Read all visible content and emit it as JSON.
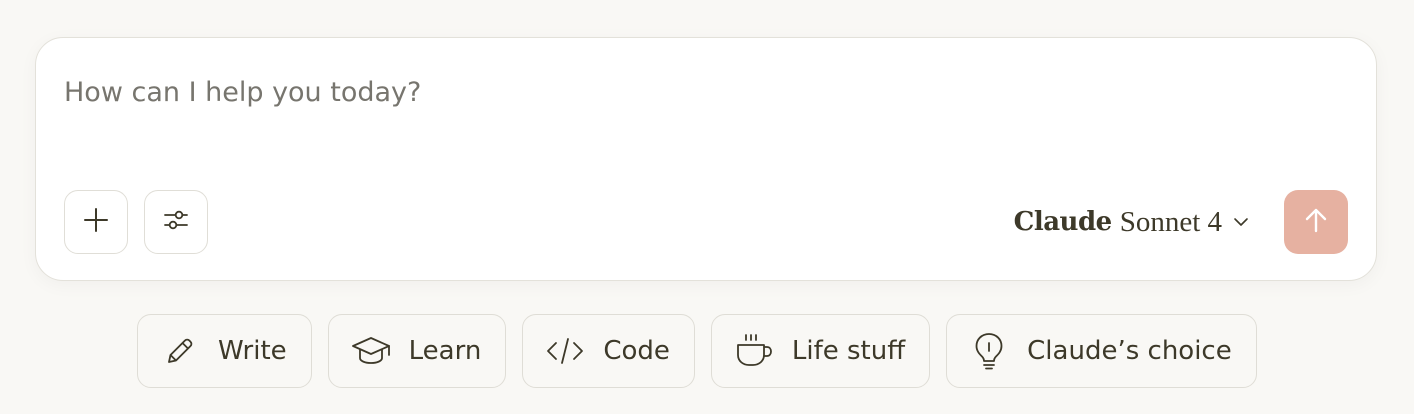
{
  "composer": {
    "placeholder": "How can I help you today?",
    "value": "",
    "add_button_icon": "plus-icon",
    "tools_button_icon": "sliders-icon",
    "model_selector": {
      "brand": "Claude",
      "model": "Sonnet 4",
      "icon": "chevron-down-icon"
    },
    "send_button_icon": "arrow-up-icon",
    "send_button_color": "#e6b1a1"
  },
  "suggestions": [
    {
      "label": "Write",
      "icon": "pencil-icon"
    },
    {
      "label": "Learn",
      "icon": "graduation-cap-icon"
    },
    {
      "label": "Code",
      "icon": "code-icon"
    },
    {
      "label": "Life stuff",
      "icon": "coffee-cup-icon"
    },
    {
      "label": "Claude’s choice",
      "icon": "lightbulb-icon"
    }
  ],
  "colors": {
    "background": "#f9f8f5",
    "text": "#3d3929",
    "placeholder": "#77756e"
  }
}
